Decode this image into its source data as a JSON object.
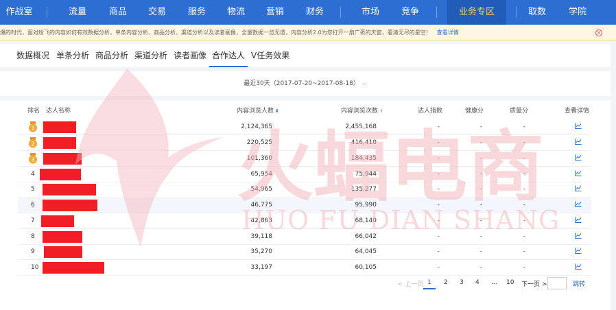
{
  "topnav": {
    "items": [
      {
        "label": "作战室"
      },
      {
        "label": "流量"
      },
      {
        "label": "商品"
      },
      {
        "label": "交易"
      },
      {
        "label": "服务"
      },
      {
        "label": "物流"
      },
      {
        "label": "营销"
      },
      {
        "label": "财务"
      },
      {
        "label": "市场"
      },
      {
        "label": "竞争"
      },
      {
        "label": "业务专区",
        "active": true
      },
      {
        "label": "取数"
      },
      {
        "label": "学院"
      }
    ]
  },
  "notice": {
    "text": "爆的时代，面对纷飞的内容如何有效数据分析，单条内容分析、商品分析、渠道分析以及读者画像，全量数据一览无遗，内容分析2.0为您打开一扇广袤的天窗，看清无尽的星空！",
    "link": "查看详情",
    "close_icon": "close-circle-icon"
  },
  "tabs": [
    {
      "label": "数据概况"
    },
    {
      "label": "单条分析"
    },
    {
      "label": "商品分析"
    },
    {
      "label": "渠道分析"
    },
    {
      "label": "读者画像"
    },
    {
      "label": "合作达人",
      "active": true
    },
    {
      "label": "V任务效果"
    }
  ],
  "date_selector": {
    "label": "最近30天（2017-07-20~2017-08-18）",
    "icon": "chevron-down-icon"
  },
  "table": {
    "headers": {
      "rank": "排名",
      "name": "达人名称",
      "visitors": "内容浏览人数",
      "views": "内容浏览次数",
      "index": "达人指数",
      "health": "健康分",
      "quality": "质量分",
      "detail": "查看详情"
    },
    "rows": [
      {
        "rank": "1",
        "medal": true,
        "visitors": "2,124,365",
        "views": "2,455,168",
        "index": "-",
        "health": "-",
        "quality": "-"
      },
      {
        "rank": "2",
        "medal": true,
        "visitors": "220,525",
        "views": "416,410",
        "index": "-",
        "health": "-",
        "quality": "-"
      },
      {
        "rank": "3",
        "medal": true,
        "visitors": "101,360",
        "views": "184,435",
        "index": "-",
        "health": "-",
        "quality": "-"
      },
      {
        "rank": "4",
        "medal": false,
        "visitors": "65,954",
        "views": "75,944",
        "index": "-",
        "health": "-",
        "quality": "-"
      },
      {
        "rank": "5",
        "medal": false,
        "visitors": "54,965",
        "views": "135,277",
        "index": "-",
        "health": "-",
        "quality": "-"
      },
      {
        "rank": "6",
        "medal": false,
        "visitors": "46,775",
        "views": "95,990",
        "index": "-",
        "health": "-",
        "quality": "-"
      },
      {
        "rank": "7",
        "medal": false,
        "visitors": "42,863",
        "views": "68,140",
        "index": "-",
        "health": "-",
        "quality": "-"
      },
      {
        "rank": "8",
        "medal": false,
        "visitors": "39,118",
        "views": "66,042",
        "index": "-",
        "health": "-",
        "quality": "-"
      },
      {
        "rank": "9",
        "medal": false,
        "visitors": "35,270",
        "views": "64,045",
        "index": "-",
        "health": "-",
        "quality": "-"
      },
      {
        "rank": "10",
        "medal": false,
        "visitors": "33,197",
        "views": "60,105",
        "index": "-",
        "health": "-",
        "quality": "-"
      }
    ]
  },
  "pagination": {
    "prev": "< 上一页",
    "pages": [
      "1",
      "2",
      "3",
      "4",
      "...",
      "10"
    ],
    "current": "1",
    "next": "下一页 >",
    "jump": "跳转"
  },
  "watermark": {
    "cn": "火蝠电商",
    "en": "HUO FU DIAN SHANG"
  },
  "colors": {
    "nav_bg": "#2d6ed3",
    "nav_active_text": "#ffd84d",
    "accent": "#2d6ed3",
    "redaction": "#f11d27",
    "medal": "#f0a93a"
  }
}
